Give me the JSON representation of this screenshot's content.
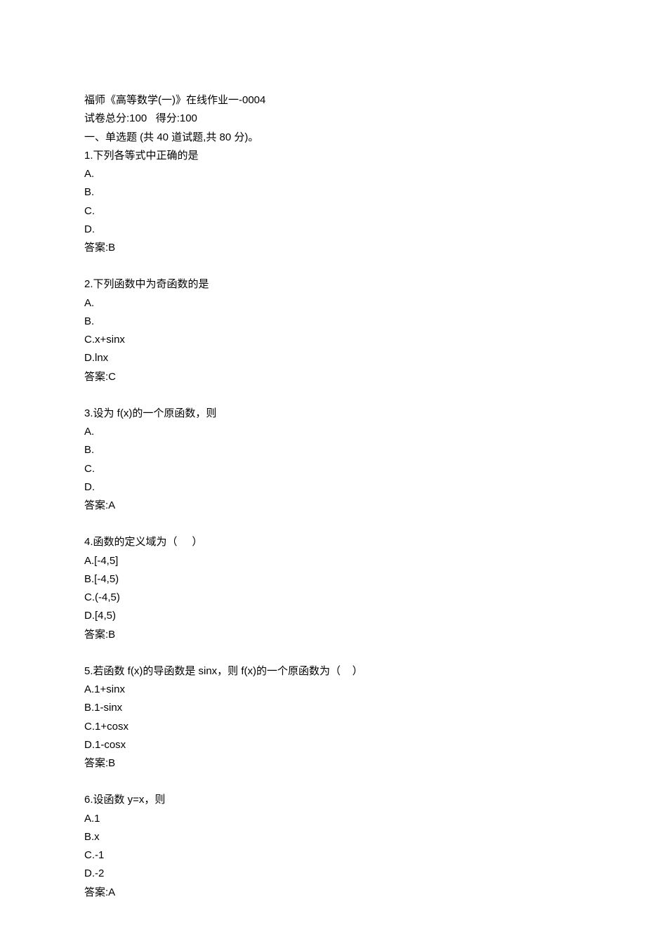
{
  "header": {
    "title": "福师《高等数学(一)》在线作业一-0004",
    "scoreline": "试卷总分:100   得分:100",
    "section": "一、单选题 (共 40 道试题,共 80 分)。"
  },
  "questions": [
    {
      "q": "1.下列各等式中正确的是",
      "opts": [
        "A.",
        "B.",
        "C.",
        "D."
      ],
      "ans": "答案:B"
    },
    {
      "q": "2.下列函数中为奇函数的是",
      "opts": [
        "A.",
        "B.",
        "C.x+sinx",
        "D.lnx"
      ],
      "ans": "答案:C"
    },
    {
      "q": "3.设为 f(x)的一个原函数，则",
      "opts": [
        "A.",
        "B.",
        "C.",
        "D."
      ],
      "ans": "答案:A"
    },
    {
      "q": "4.函数的定义域为（     ）",
      "opts": [
        "A.[-4,5]",
        "B.[-4,5)",
        "C.(-4,5)",
        "D.[4,5)"
      ],
      "ans": "答案:B"
    },
    {
      "q": "5.若函数 f(x)的导函数是 sinx，则 f(x)的一个原函数为（    ）",
      "opts": [
        "A.1+sinx",
        "B.1-sinx",
        "C.1+cosx",
        "D.1-cosx"
      ],
      "ans": "答案:B"
    },
    {
      "q": "6.设函数 y=x，则",
      "opts": [
        "A.1",
        "B.x",
        "C.-1",
        "D.-2"
      ],
      "ans": "答案:A"
    }
  ]
}
